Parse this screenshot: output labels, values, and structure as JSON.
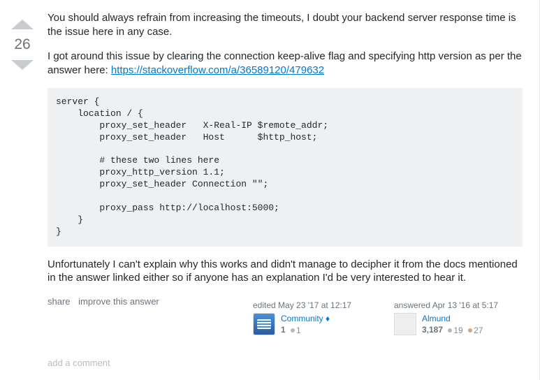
{
  "vote": {
    "score": "26"
  },
  "body": {
    "para1": "You should always refrain from increasing the timeouts, I doubt your backend server response time is the issue here in any case.",
    "para2_pre": "I got around this issue by clearing the connection keep-alive flag and specifying http version as per the answer here: ",
    "para2_link": "https://stackoverflow.com/a/36589120/479632",
    "code": "server {\n    location / {\n        proxy_set_header   X-Real-IP $remote_addr;\n        proxy_set_header   Host      $http_host;\n\n        # these two lines here\n        proxy_http_version 1.1;\n        proxy_set_header Connection \"\";\n\n        proxy_pass http://localhost:5000;\n    }\n}",
    "para3": "Unfortunately I can't explain why this works and didn't manage to decipher it from the docs mentioned in the answer linked either so if anyone has an explanation I'd be very interested to hear it."
  },
  "menu": {
    "share": "share",
    "improve": "improve this answer"
  },
  "editor": {
    "action": "edited May 23 '17 at 12:17",
    "name": "Community",
    "diamond": "♦",
    "rep": "1",
    "silver": "1"
  },
  "author": {
    "action": "answered Apr 13 '16 at 5:17",
    "name": "Almund",
    "rep": "3,187",
    "silver": "19",
    "bronze": "27"
  },
  "add_comment": "add a comment"
}
